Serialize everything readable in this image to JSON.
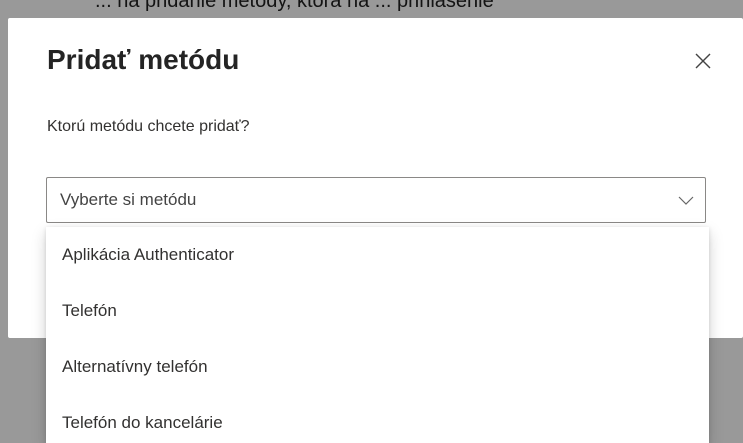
{
  "backdrop": {
    "top_text": "... na pridanie metódy, ktorá na ... prihlásenie"
  },
  "dialog": {
    "title": "Pridať metódu",
    "question": "Ktorú metódu chcete pridať?",
    "close_icon": "close-icon"
  },
  "select": {
    "value": "Vyberte si metódu",
    "chevron_icon": "chevron-down-icon"
  },
  "options": [
    {
      "label": "Aplikácia Authenticator"
    },
    {
      "label": "Telefón"
    },
    {
      "label": "Alternatívny telefón"
    },
    {
      "label": "Telefón do kancelárie"
    }
  ],
  "colors": {
    "overlay": "#666666",
    "dialog_bg": "#ffffff",
    "text": "#323130",
    "border": "#8a8886"
  }
}
